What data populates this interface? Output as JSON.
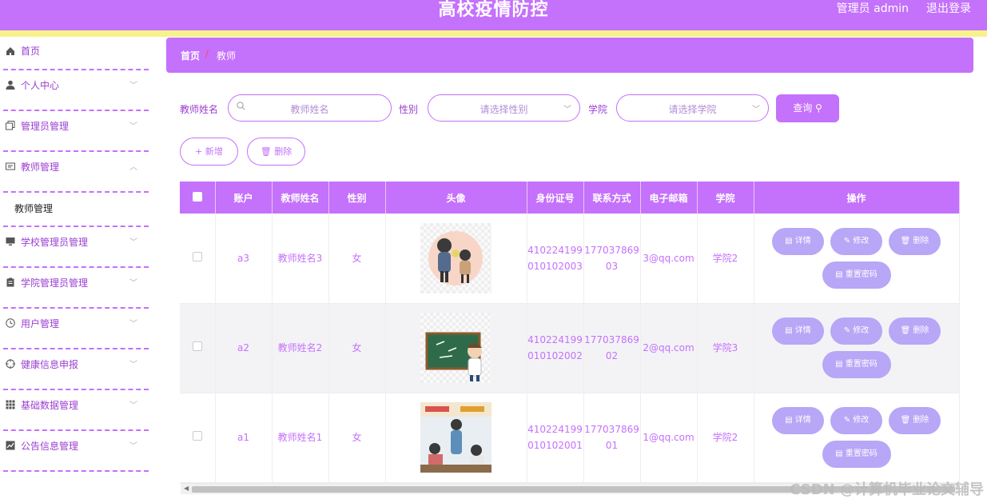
{
  "header": {
    "title": "高校疫情防控",
    "user": "管理员 admin",
    "logout": "退出登录"
  },
  "sidebar": {
    "items": [
      {
        "label": "首页",
        "icon": "home-icon"
      },
      {
        "label": "个人中心",
        "icon": "user-icon"
      },
      {
        "label": "管理员管理",
        "icon": "copy-icon"
      },
      {
        "label": "教师管理",
        "icon": "id-card-icon"
      },
      {
        "label": "教师管理",
        "icon": ""
      },
      {
        "label": "学校管理员管理",
        "icon": "monitor-icon"
      },
      {
        "label": "学院管理员管理",
        "icon": "clipboard-icon"
      },
      {
        "label": "用户管理",
        "icon": "clock-icon"
      },
      {
        "label": "健康信息申报",
        "icon": "target-icon"
      },
      {
        "label": "基础数据管理",
        "icon": "grid-icon"
      },
      {
        "label": "公告信息管理",
        "icon": "chart-icon"
      }
    ]
  },
  "breadcrumb": {
    "home": "首页",
    "sep": "/",
    "current": "教师"
  },
  "search": {
    "name_label": "教师姓名",
    "name_placeholder": "教师姓名",
    "gender_label": "性别",
    "gender_placeholder": "请选择性别",
    "college_label": "学院",
    "college_placeholder": "请选择学院",
    "query_button": "查询 ⚲"
  },
  "actions": {
    "add": "+ 新增",
    "delete": "🗑 删除"
  },
  "table": {
    "headers": [
      "账户",
      "教师姓名",
      "性别",
      "头像",
      "身份证号",
      "联系方式",
      "电子邮箱",
      "学院",
      "操作"
    ],
    "rows": [
      {
        "account": "a3",
        "name": "教师姓名3",
        "gender": "女",
        "idcard": "410224199010102003",
        "phone": "17703786903",
        "email": "3@qq.com",
        "college": "学院2"
      },
      {
        "account": "a2",
        "name": "教师姓名2",
        "gender": "女",
        "idcard": "410224199010102002",
        "phone": "17703786902",
        "email": "2@qq.com",
        "college": "学院3"
      },
      {
        "account": "a1",
        "name": "教师姓名1",
        "gender": "女",
        "idcard": "410224199010102001",
        "phone": "17703786901",
        "email": "1@qq.com",
        "college": "学院2"
      }
    ],
    "ops": {
      "detail": "▤ 详情",
      "edit": "✎ 修改",
      "delete": "🗑 删除",
      "reset": "▤ 重置密码"
    }
  },
  "watermark": "CSDN @计算机毕业论文辅导",
  "colors": {
    "accent": "#c471fb",
    "yellow": "#f7f28b",
    "op_button": "#b8a6f7"
  }
}
